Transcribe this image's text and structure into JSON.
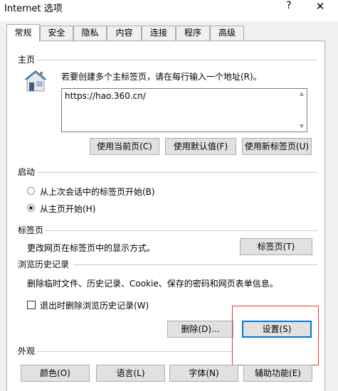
{
  "window": {
    "title": "Internet 选项",
    "help_label": "?",
    "close_label": "✕"
  },
  "tabs": [
    {
      "label": "常规",
      "active": true
    },
    {
      "label": "安全"
    },
    {
      "label": "隐私"
    },
    {
      "label": "内容"
    },
    {
      "label": "连接"
    },
    {
      "label": "程序"
    },
    {
      "label": "高级"
    }
  ],
  "home": {
    "section_title": "主页",
    "instruction": "若要创建多个主标签页，请在每行输入一个地址(R)。",
    "url": "https://hao.360.cn/",
    "btn_current": "使用当前页(C)",
    "btn_default": "使用默认值(F)",
    "btn_newtab": "使用新标签页(U)"
  },
  "startup": {
    "section_title": "启动",
    "option_last_session": "从上次会话中的标签页开始(B)",
    "option_home": "从主页开始(H)",
    "selected": "option_home"
  },
  "tabs_section": {
    "section_title": "标签页",
    "description": "更改网页在标签页中的显示方式。",
    "button": "标签页(T)"
  },
  "history": {
    "section_title": "浏览历史记录",
    "description": "删除临时文件、历史记录、Cookie、保存的密码和网页表单信息。",
    "checkbox_label": "退出时删除浏览历史记录(W)",
    "checkbox_checked": false,
    "btn_delete": "删除(D)...",
    "btn_settings": "设置(S)"
  },
  "appearance": {
    "section_title": "外观",
    "btn_colors": "颜色(O)",
    "btn_languages": "语言(L)",
    "btn_fonts": "字体(N)",
    "btn_accessibility": "辅助功能(E)"
  },
  "colors": {
    "highlight": "#e53935",
    "focus": "#0078d7"
  }
}
